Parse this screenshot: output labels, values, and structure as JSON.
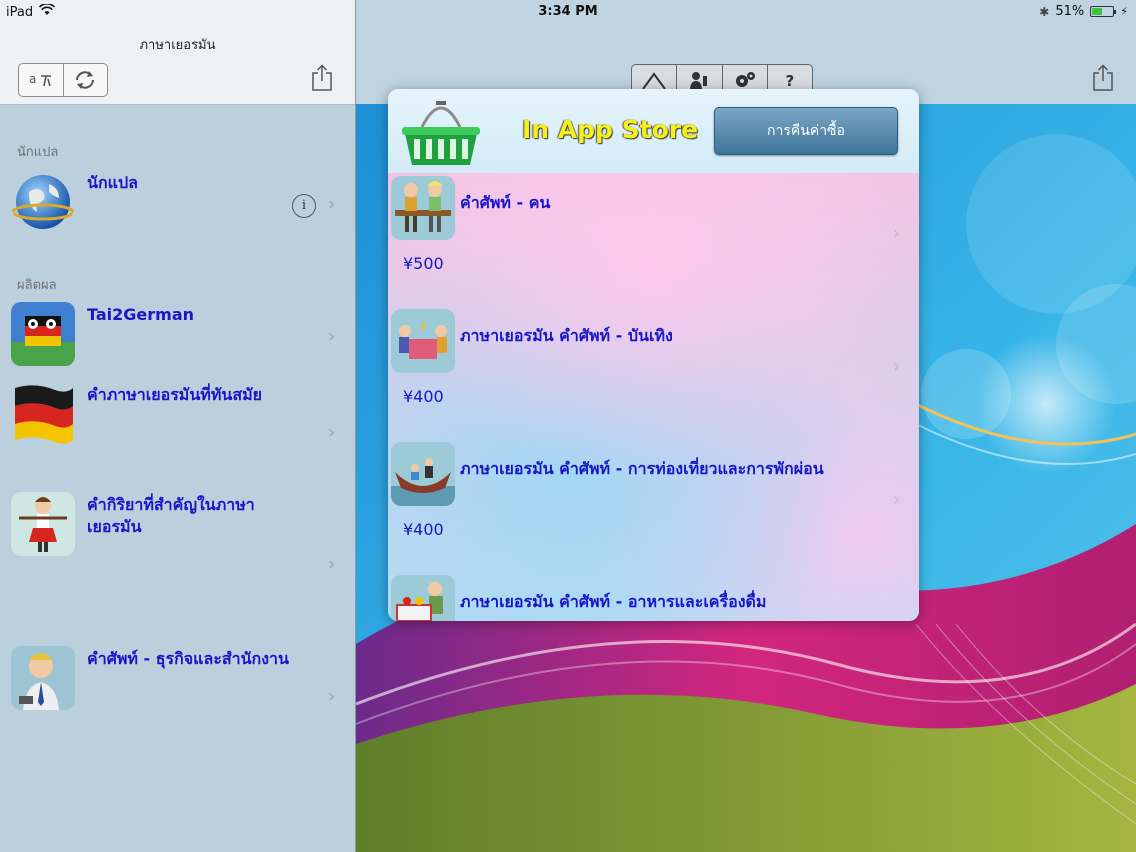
{
  "status_bar": {
    "device": "iPad",
    "time": "3:34 PM",
    "battery": "51%",
    "battery_level": 0.51
  },
  "sidebar": {
    "title": "ภาษาเยอรมัน",
    "sections": [
      {
        "title": "นักแปล",
        "items": [
          {
            "label": "นักแปล"
          }
        ]
      },
      {
        "title": "ผลิตผล",
        "items": [
          {
            "label": "Tai2German"
          },
          {
            "label": "คำภาษาเยอรมันที่ทันสมัย"
          },
          {
            "label": "คำกิริยาที่สำคัญในภาษาเยอรมัน"
          },
          {
            "label": "คำศัพท์ - ธุรกิจและสำนักงาน"
          }
        ]
      }
    ]
  },
  "toolbar": {
    "help_label": "?"
  },
  "store": {
    "title": "In App Store",
    "restore_label": "การคืนค่าซื้อ",
    "products": [
      {
        "name": "คำศัพท์ - คน",
        "price": "¥500"
      },
      {
        "name": "ภาษาเยอรมัน คำศัพท์ - บันเทิง",
        "price": "¥400"
      },
      {
        "name": "ภาษาเยอรมัน คำศัพท์ - การท่องเที่ยวและการพักผ่อน",
        "price": "¥400"
      },
      {
        "name": "ภาษาเยอรมัน คำศัพท์ - อาหารและเครื่องดื่ม",
        "price": ""
      }
    ]
  },
  "colors": {
    "link_blue": "#1717c8",
    "title_yellow": "#f5ef1a",
    "button_blue": "#3e7499"
  }
}
